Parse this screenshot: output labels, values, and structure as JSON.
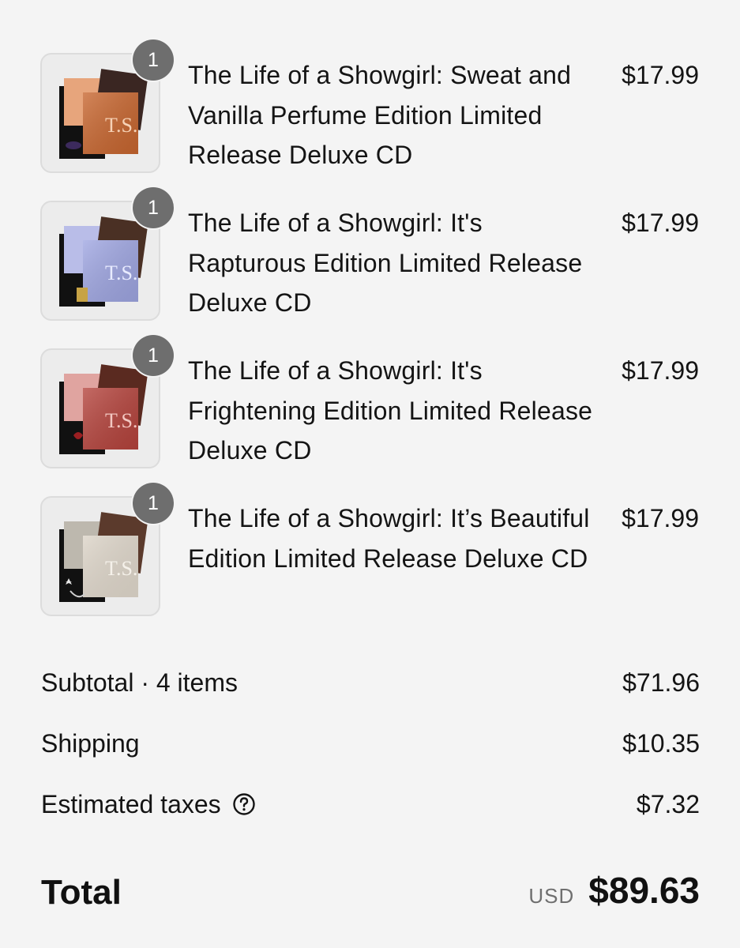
{
  "line_items": [
    {
      "quantity": "1",
      "title": "The Life of a Showgirl: Sweat and Vanilla Perfume Edition Limited Release Deluxe CD",
      "price": "$17.99",
      "thumbnail_icon": "cd-bundle-orange-image",
      "thumbnail_color": "#c8662f"
    },
    {
      "quantity": "1",
      "title": "The Life of a Showgirl: It's Rapturous Edition Limited Release Deluxe CD",
      "price": "$17.99",
      "thumbnail_icon": "cd-bundle-lavender-image",
      "thumbnail_color": "#9fa6e2"
    },
    {
      "quantity": "1",
      "title": "The Life of a Showgirl: It's Frightening Edition Limited Release Deluxe CD",
      "price": "$17.99",
      "thumbnail_icon": "cd-bundle-red-image",
      "thumbnail_color": "#b5433c"
    },
    {
      "quantity": "1",
      "title": "The Life of a Showgirl: It’s Beautiful Edition Limited Release Deluxe CD",
      "price": "$17.99",
      "thumbnail_icon": "cd-bundle-silver-image",
      "thumbnail_color": "#ddd5c9"
    }
  ],
  "summary": {
    "subtotal_label": "Subtotal · 4 items",
    "subtotal_value": "$71.96",
    "shipping_label": "Shipping",
    "shipping_value": "$10.35",
    "taxes_label": "Estimated taxes",
    "taxes_value": "$7.32",
    "taxes_help_icon": "question-circle-icon"
  },
  "total": {
    "label": "Total",
    "currency": "USD",
    "value": "$89.63"
  },
  "colors": {
    "background": "#f4f4f4",
    "badge": "#6e6e6e",
    "text": "#141414",
    "muted": "#6f6f6f"
  }
}
